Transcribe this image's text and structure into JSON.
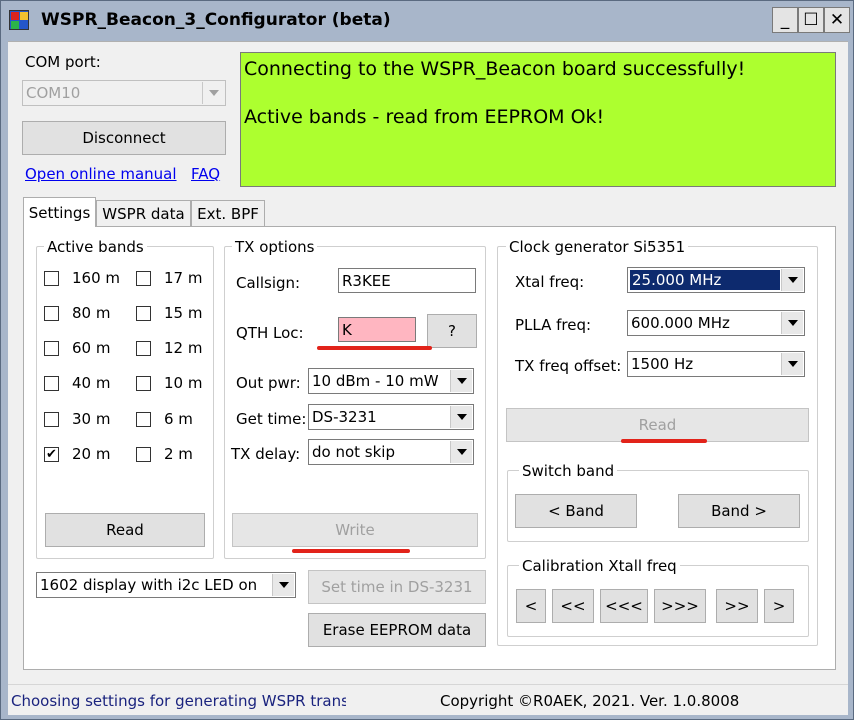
{
  "window": {
    "title": "WSPR_Beacon_3_Configurator (beta)",
    "minimize_glyph": "_",
    "maximize_glyph": "☐",
    "close_glyph": "✕"
  },
  "com": {
    "label": "COM port:",
    "value": "COM10",
    "disconnect_label": "Disconnect"
  },
  "links": {
    "manual": "Open online manual",
    "faq": "FAQ"
  },
  "log": {
    "line1": "Connecting to the WSPR_Beacon board successfully!",
    "line2": "Active bands - read from EEPROM Ok!",
    "bg_color": "#adff2f"
  },
  "tabs": [
    "Settings",
    "WSPR data",
    "Ext. BPF"
  ],
  "active_bands": {
    "title": "Active bands",
    "bands": [
      {
        "label": "160 m",
        "checked": false
      },
      {
        "label": "17 m",
        "checked": false
      },
      {
        "label": "80 m",
        "checked": false
      },
      {
        "label": "15 m",
        "checked": false
      },
      {
        "label": "60 m",
        "checked": false
      },
      {
        "label": "12 m",
        "checked": false
      },
      {
        "label": "40 m",
        "checked": false
      },
      {
        "label": "10 m",
        "checked": false
      },
      {
        "label": "30 m",
        "checked": false
      },
      {
        "label": "6 m",
        "checked": false
      },
      {
        "label": "20 m",
        "checked": true
      },
      {
        "label": "2 m",
        "checked": false
      }
    ],
    "read_label": "Read"
  },
  "tx_options": {
    "title": "TX options",
    "callsign_label": "Callsign:",
    "callsign_value": "R3KEE",
    "qth_label": "QTH Loc:",
    "qth_value": "K",
    "qth_help_label": "?",
    "out_pwr_label": "Out pwr:",
    "out_pwr_value": "10 dBm - 10 mW",
    "get_time_label": "Get time:",
    "get_time_value": "DS-3231",
    "tx_delay_label": "TX delay:",
    "tx_delay_value": "do not skip",
    "write_label": "Write"
  },
  "clock": {
    "title": "Clock generator Si5351",
    "xtal_label": "Xtal freq:",
    "xtal_value": "25.000 MHz",
    "plla_label": "PLLA freq:",
    "plla_value": "600.000 MHz",
    "offset_label": "TX freq offset:",
    "offset_value": "1500 Hz",
    "read_label": "Read"
  },
  "switch_band": {
    "title": "Switch band",
    "prev_label": "< Band",
    "next_label": "Band >"
  },
  "calibration": {
    "title": "Calibration Xtall freq",
    "buttons": [
      "<",
      "<<",
      "<<<",
      ">>>",
      ">>",
      ">"
    ]
  },
  "display": {
    "value": "1602 display with i2c LED on",
    "set_time_label": "Set time in DS-3231",
    "erase_label": "Erase EEPROM data"
  },
  "status": {
    "left": "Choosing settings for generating WSPR transm",
    "right": "Copyright ©R0AEK, 2021. Ver. 1.0.8008"
  }
}
